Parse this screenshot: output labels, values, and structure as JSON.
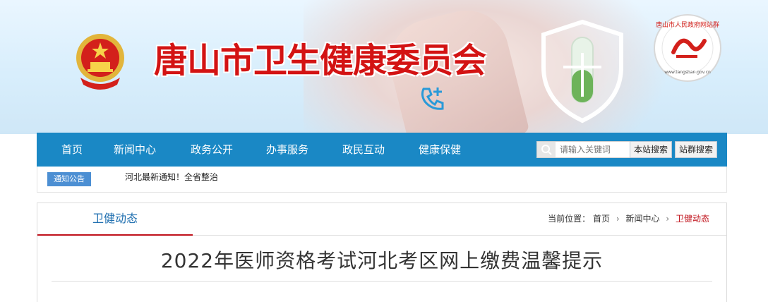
{
  "header": {
    "site_title": "唐山市卫生健康委员会",
    "seal_text": "唐山市人民政府网站群成员",
    "seal_url": "www.tangshan.gov.cn"
  },
  "nav": {
    "items": [
      "首页",
      "新闻中心",
      "政务公开",
      "办事服务",
      "政民互动",
      "健康保健"
    ],
    "search_placeholder": "请输入关键词",
    "site_search_label": "本站搜索",
    "group_search_label": "站群搜索"
  },
  "notice": {
    "tag": "通知公告",
    "text": "河北最新通知！全省整治"
  },
  "panel": {
    "tab": "卫健动态",
    "breadcrumb": {
      "prefix": "当前位置：",
      "items": [
        "首页",
        "新闻中心",
        "卫健动态"
      ]
    },
    "article_title": "2022年医师资格考试河北考区网上缴费温馨提示"
  },
  "colors": {
    "nav_bg": "#1a88c5",
    "title_red": "#d31313",
    "accent_red": "#c0121b",
    "tag_blue": "#4c8fd3"
  }
}
